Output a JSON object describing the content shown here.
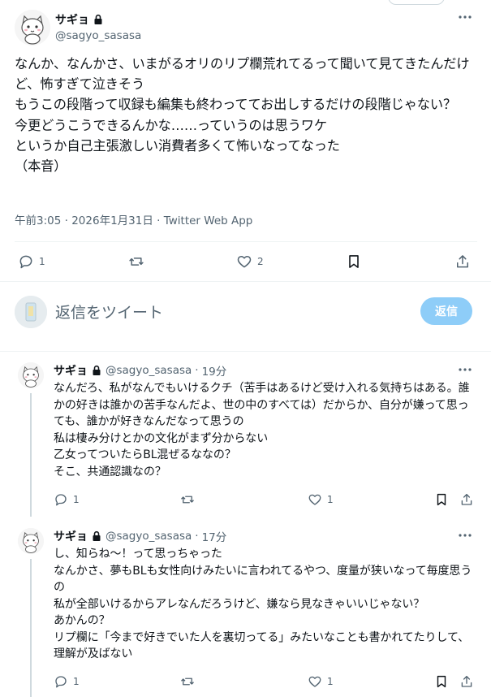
{
  "main_tweet": {
    "display_name": "サギョ",
    "handle": "@sagyo_sasasa",
    "text": "なんか、なんかさ、いまがるオリのリプ欄荒れてるって聞いて見てきたんだけど、怖すぎて泣きそう\nもうこの段階って収録も編集も終わっててお出しするだけの段階じゃない？\n今更どうこうできるんかな……っていうのは思うワケ\nというか自己主張激しい消費者多くて怖いなってなった\n（本音）",
    "time": "午前3:05",
    "date": "2026年1月31日",
    "source": "Twitter Web App",
    "replies": "1",
    "retweets": "",
    "likes": "2"
  },
  "reply_box": {
    "placeholder": "返信をツイート",
    "button_label": "返信"
  },
  "replies": [
    {
      "display_name": "サギョ",
      "handle": "@sagyo_sasasa",
      "time_ago": "19分",
      "text": "なんだろ、私がなんでもいけるクチ（苦手はあるけど受け入れる気持ちはある。誰かの好きは誰かの苦手なんだよ、世の中のすべては）だからか、自分が嫌って思っても、誰かが好きなんだなって思うの\n私は棲み分けとかの文化がまず分からない\n乙女ってついたらBL混ぜるななの？\nそこ、共通認識なの？",
      "replies": "1",
      "retweets": "",
      "likes": "1"
    },
    {
      "display_name": "サギョ",
      "handle": "@sagyo_sasasa",
      "time_ago": "17分",
      "text": "し、知らね〜！って思っちゃった\nなんかさ、夢もBLも女性向けみたいに言われてるやつ、度量が狭いなって毎度思うの\n私が全部いけるからアレなんだろうけど、嫌なら見なきゃいいじゃない？\nあかんの？\nリプ欄に「今まで好きでいた人を裏切ってる」みたいなことも書かれてたりして、理解が及ばない",
      "replies": "1",
      "retweets": "",
      "likes": "1"
    }
  ],
  "icons": {
    "lock": "lock-icon",
    "more": "more-icon",
    "reply": "reply-icon",
    "retweet": "retweet-icon",
    "like": "heart-icon",
    "bookmark": "bookmark-icon",
    "share": "share-icon"
  },
  "colors": {
    "text": "#0f1419",
    "secondary": "#536471",
    "border": "#eff3f4",
    "reply_button": "#8ecdf8"
  }
}
